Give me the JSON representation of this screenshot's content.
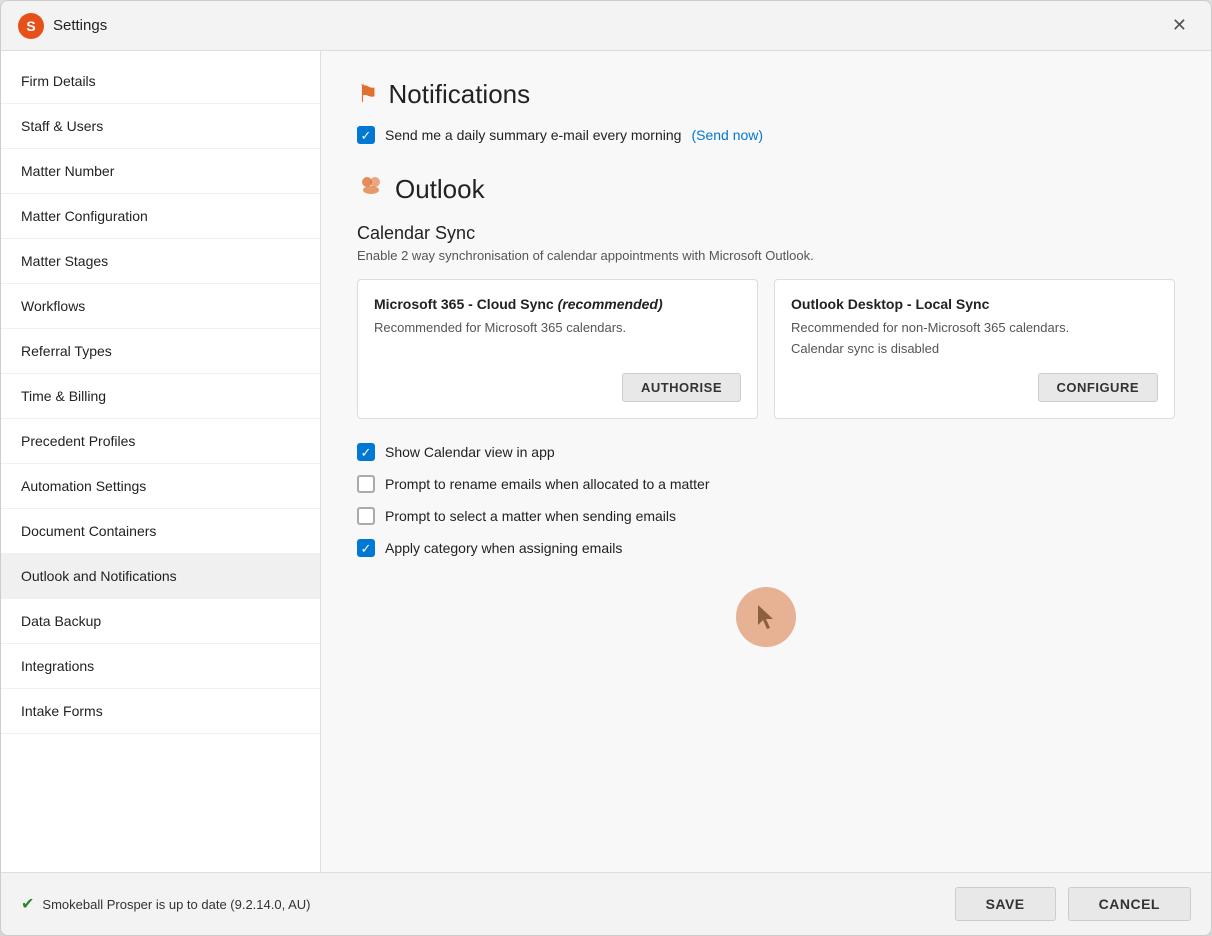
{
  "window": {
    "title": "Settings",
    "close_label": "✕"
  },
  "sidebar": {
    "items": [
      {
        "id": "firm-details",
        "label": "Firm Details",
        "active": false
      },
      {
        "id": "staff-users",
        "label": "Staff & Users",
        "active": false
      },
      {
        "id": "matter-number",
        "label": "Matter Number",
        "active": false
      },
      {
        "id": "matter-configuration",
        "label": "Matter Configuration",
        "active": false
      },
      {
        "id": "matter-stages",
        "label": "Matter Stages",
        "active": false
      },
      {
        "id": "workflows",
        "label": "Workflows",
        "active": false
      },
      {
        "id": "referral-types",
        "label": "Referral Types",
        "active": false
      },
      {
        "id": "time-billing",
        "label": "Time & Billing",
        "active": false
      },
      {
        "id": "precedent-profiles",
        "label": "Precedent Profiles",
        "active": false
      },
      {
        "id": "automation-settings",
        "label": "Automation Settings",
        "active": false
      },
      {
        "id": "document-containers",
        "label": "Document Containers",
        "active": false
      },
      {
        "id": "outlook-notifications",
        "label": "Outlook and Notifications",
        "active": true
      },
      {
        "id": "data-backup",
        "label": "Data Backup",
        "active": false
      },
      {
        "id": "integrations",
        "label": "Integrations",
        "active": false
      },
      {
        "id": "intake-forms",
        "label": "Intake Forms",
        "active": false
      }
    ]
  },
  "content": {
    "notifications_title": "Notifications",
    "notifications_icon": "🚩",
    "daily_summary_label": "Send me a daily summary e-mail every morning",
    "send_now_label": "(Send now)",
    "daily_summary_checked": true,
    "outlook_title": "Outlook",
    "outlook_icon": "👥",
    "calendar_sync_title": "Calendar Sync",
    "calendar_sync_desc": "Enable 2 way synchronisation of calendar appointments with Microsoft Outlook.",
    "ms365_card": {
      "title_prefix": "Microsoft 365 - Cloud Sync ",
      "title_italic": "(recommended)",
      "desc": "Recommended for Microsoft 365 calendars.",
      "button_label": "AUTHORISE"
    },
    "outlook_desktop_card": {
      "title": "Outlook Desktop - Local Sync",
      "desc": "Recommended for non-Microsoft 365 calendars.",
      "status": "Calendar sync is disabled",
      "button_label": "CONFIGURE"
    },
    "checkboxes": [
      {
        "id": "show-calendar",
        "label": "Show Calendar view in app",
        "checked": true
      },
      {
        "id": "prompt-rename",
        "label": "Prompt to rename emails when allocated to a matter",
        "checked": false
      },
      {
        "id": "prompt-select",
        "label": "Prompt to select a matter when sending emails",
        "checked": false
      },
      {
        "id": "apply-category",
        "label": "Apply category when assigning emails",
        "checked": true
      }
    ]
  },
  "footer": {
    "status_text": "Smokeball Prosper is up to date (9.2.14.0, AU)",
    "save_label": "SAVE",
    "cancel_label": "CANCEL"
  }
}
